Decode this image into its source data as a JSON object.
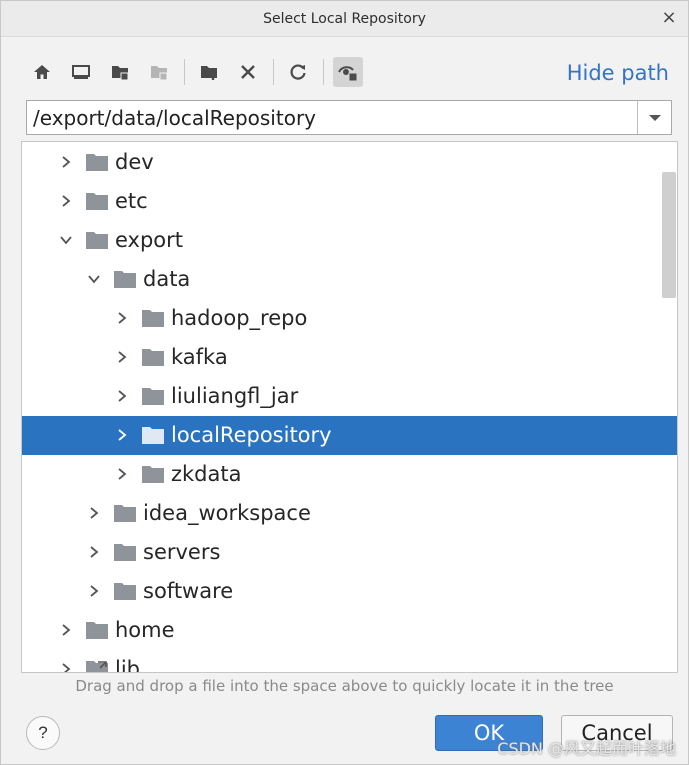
{
  "window": {
    "title": "Select Local Repository",
    "close_glyph": "×"
  },
  "toolbar": {
    "buttons": [
      {
        "name": "home-icon"
      },
      {
        "name": "desktop-icon"
      },
      {
        "name": "project-folder-icon"
      },
      {
        "name": "module-folder-icon"
      },
      {
        "name": "new-folder-icon"
      },
      {
        "name": "delete-icon"
      },
      {
        "name": "refresh-icon"
      },
      {
        "name": "show-hidden-icon"
      }
    ],
    "hide_path_label": "Hide path"
  },
  "path": {
    "value": "/export/data/localRepository"
  },
  "tree": {
    "items": [
      {
        "label": "dev",
        "level": 0,
        "expanded": false,
        "selected": false
      },
      {
        "label": "etc",
        "level": 0,
        "expanded": false,
        "selected": false
      },
      {
        "label": "export",
        "level": 0,
        "expanded": true,
        "selected": false
      },
      {
        "label": "data",
        "level": 1,
        "expanded": true,
        "selected": false
      },
      {
        "label": "hadoop_repo",
        "level": 2,
        "expanded": false,
        "selected": false
      },
      {
        "label": "kafka",
        "level": 2,
        "expanded": false,
        "selected": false
      },
      {
        "label": "liuliangfl_jar",
        "level": 2,
        "expanded": false,
        "selected": false
      },
      {
        "label": "localRepository",
        "level": 2,
        "expanded": false,
        "selected": true
      },
      {
        "label": "zkdata",
        "level": 2,
        "expanded": false,
        "selected": false
      },
      {
        "label": "idea_workspace",
        "level": 1,
        "expanded": false,
        "selected": false
      },
      {
        "label": "servers",
        "level": 1,
        "expanded": false,
        "selected": false
      },
      {
        "label": "software",
        "level": 1,
        "expanded": false,
        "selected": false
      },
      {
        "label": "home",
        "level": 0,
        "expanded": false,
        "selected": false
      },
      {
        "label": "lib",
        "level": 0,
        "expanded": false,
        "selected": false,
        "symlink": true
      }
    ]
  },
  "hint": "Drag and drop a file into the space above to quickly locate it in the tree",
  "footer": {
    "help_label": "?",
    "ok_label": "OK",
    "cancel_label": "Cancel"
  },
  "watermark": "CSDN @风又起而叶落地",
  "colors": {
    "accent": "#2a73c1",
    "link": "#3573c7",
    "folder": "#8e9499"
  }
}
